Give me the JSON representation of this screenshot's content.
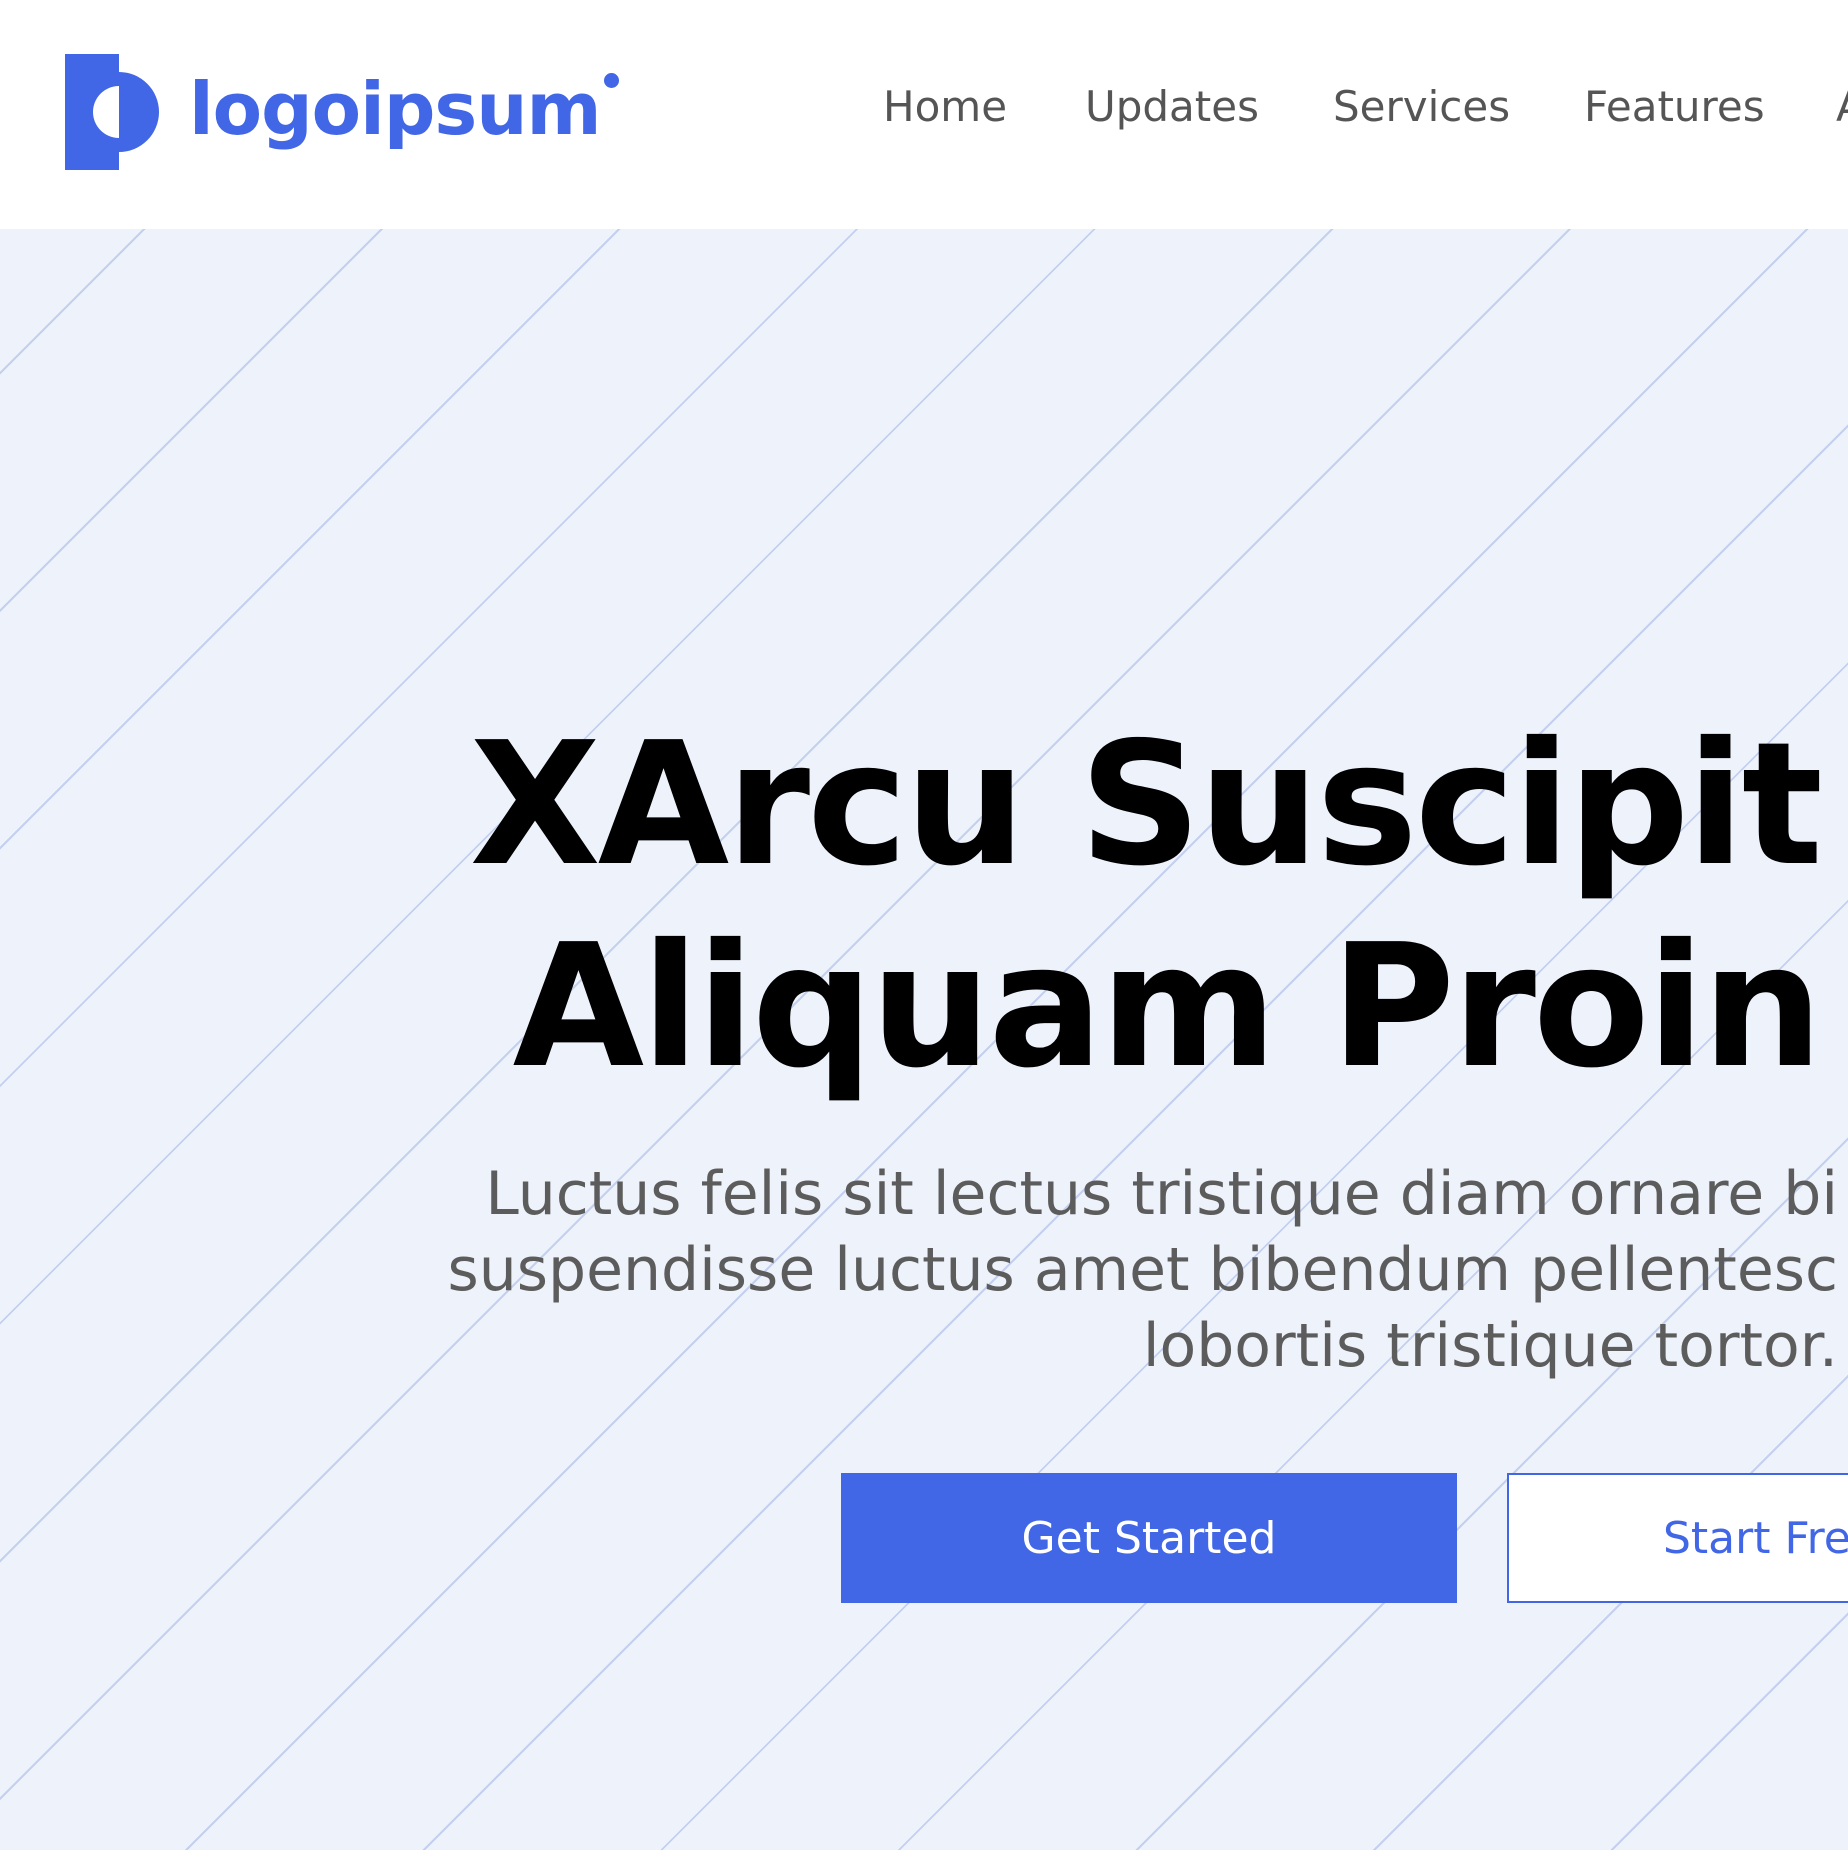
{
  "brand": {
    "name": "logoipsum",
    "color": "#4166e6"
  },
  "nav": {
    "items": [
      {
        "label": "Home"
      },
      {
        "label": "Updates"
      },
      {
        "label": "Services"
      },
      {
        "label": "Features"
      },
      {
        "label": "A"
      }
    ]
  },
  "hero": {
    "title_lines": [
      "XArcu Suscipit",
      "Aliquam Proin"
    ],
    "subtitle_lines": [
      "Luctus felis sit lectus tristique diam ornare bi",
      "suspendisse luctus amet bibendum pellentesc",
      "lobortis tristique tortor."
    ],
    "primary_button": "Get Started",
    "secondary_button": "Start Free",
    "background_color": "#eef2fb",
    "stripe_color": "#c3d0f0"
  }
}
